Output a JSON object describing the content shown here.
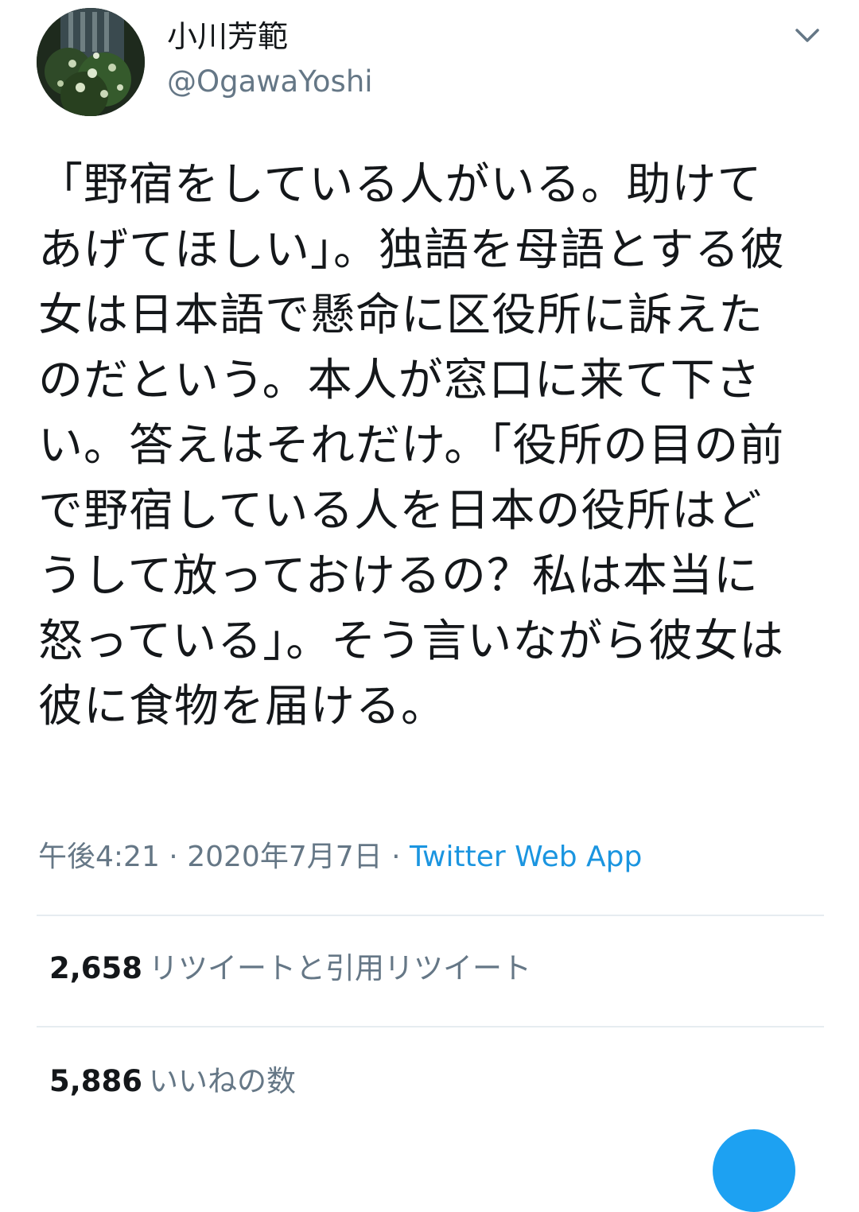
{
  "author": {
    "display_name": "小川芳範",
    "handle": "@OgawaYoshi"
  },
  "tweet": {
    "text": "「野宿をしている人がいる。助けてあげてほしい」。独語を母語とする彼女は日本語で懸命に区役所に訴えたのだという。本人が窓口に来て下さい。答えはそれだけ。「役所の目の前で野宿している人を日本の役所はどうして放っておけるの？私は本当に怒っている」。そう言いながら彼女は彼に食物を届ける。",
    "time": "午後4:21",
    "separator": "·",
    "date": "2020年7月7日",
    "source": "Twitter Web App"
  },
  "stats": {
    "retweets": {
      "count": "2,658",
      "label": "リツイートと引用リツイート"
    },
    "likes": {
      "count": "5,886",
      "label": "いいねの数"
    }
  },
  "icons": {
    "caret": "chevron-down-icon",
    "avatar": "profile-photo"
  },
  "colors": {
    "text": "#14171a",
    "secondary": "#657786",
    "link": "#1b95e0",
    "divider": "#e6ecf0",
    "accent": "#1da1f2"
  }
}
